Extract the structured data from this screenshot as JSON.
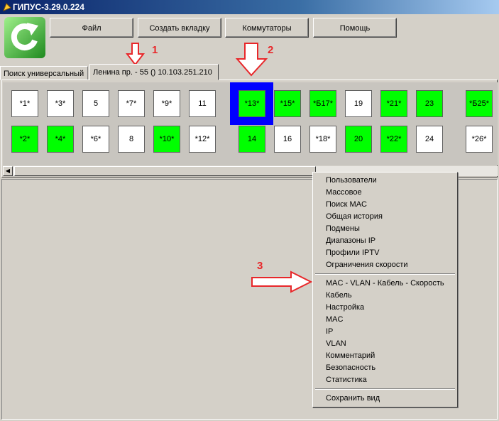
{
  "window": {
    "title": "ГИПУС-3.29.0.224"
  },
  "toolbar": {
    "buttons": [
      "Файл",
      "Создать вкладку",
      "Коммутаторы",
      "Помощь"
    ]
  },
  "tabs": [
    "Поиск универсальный",
    "Ленина пр. - 55 () 10.103.251.210"
  ],
  "ports": {
    "top": [
      {
        "label": "*1*",
        "green": false
      },
      {
        "label": "*3*",
        "green": false
      },
      {
        "label": "5",
        "green": false
      },
      {
        "label": "*7*",
        "green": false
      },
      {
        "label": "*9*",
        "green": false
      },
      {
        "label": "11",
        "green": false
      },
      {
        "label": "*13*",
        "green": true
      },
      {
        "label": "*15*",
        "green": true
      },
      {
        "label": "*Б17*",
        "green": true
      },
      {
        "label": "19",
        "green": false
      },
      {
        "label": "*21*",
        "green": true
      },
      {
        "label": "23",
        "green": true
      },
      {
        "label": "*Б25*",
        "green": true
      }
    ],
    "bottom": [
      {
        "label": "*2*",
        "green": true
      },
      {
        "label": "*4*",
        "green": true
      },
      {
        "label": "*6*",
        "green": false
      },
      {
        "label": "8",
        "green": false
      },
      {
        "label": "*10*",
        "green": true
      },
      {
        "label": "*12*",
        "green": false
      },
      {
        "label": "14",
        "green": true
      },
      {
        "label": "16",
        "green": false
      },
      {
        "label": "*18*",
        "green": false
      },
      {
        "label": "20",
        "green": true
      },
      {
        "label": "*22*",
        "green": true
      },
      {
        "label": "24",
        "green": false
      },
      {
        "label": "*26*",
        "green": false
      }
    ],
    "selected": "*13*"
  },
  "context_menu": {
    "group1": [
      "Пользователи",
      "Массовое",
      "Поиск MAC",
      "Общая история",
      "Подмены",
      "Диапазоны IP",
      "Профили IPTV",
      "Ограничения скорости"
    ],
    "group2": [
      "MAC - VLAN - Кабель - Скорость",
      "Кабель",
      "Настройка",
      "MAC",
      "IP",
      "VLAN",
      "Комментарий",
      "Безопасность",
      "Статистика"
    ],
    "group3": [
      "Сохранить вид"
    ]
  },
  "annotations": [
    "1",
    "2",
    "3"
  ],
  "colors": {
    "port_green": "#00ff00",
    "selection": "#0000ff",
    "annotation": "#e8272a"
  }
}
